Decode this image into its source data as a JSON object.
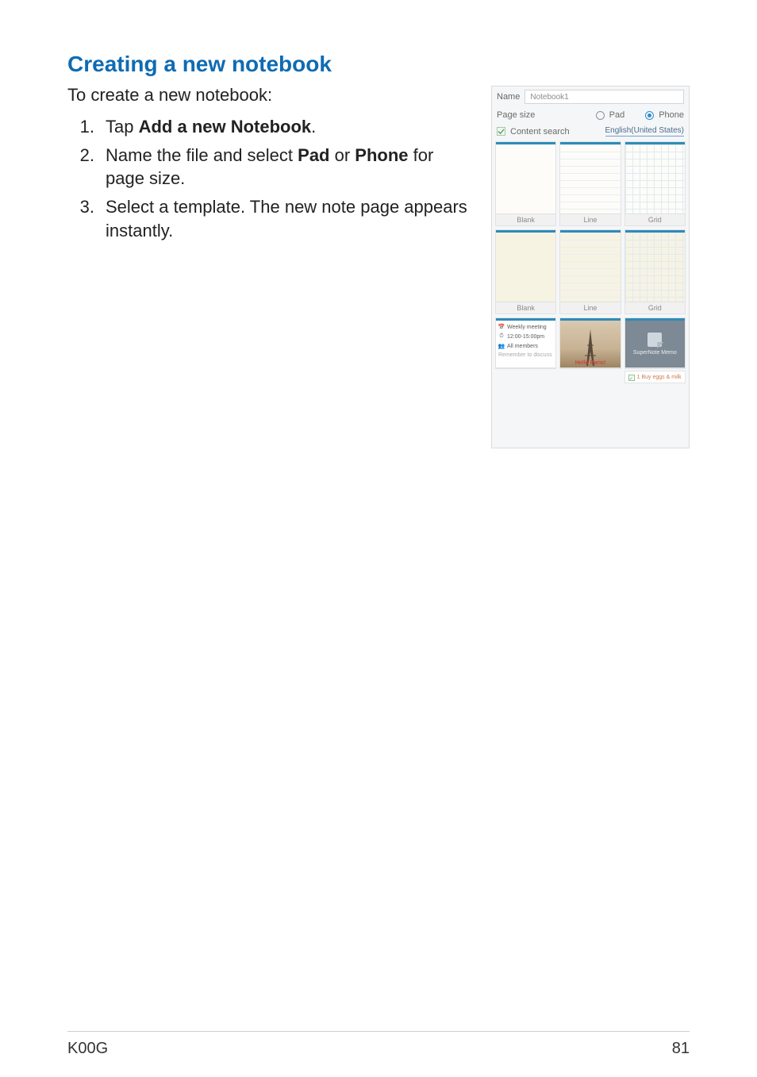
{
  "heading": "Creating a new notebook",
  "intro": "To create a new notebook:",
  "steps": {
    "s1": {
      "num": "1.",
      "pre": "Tap ",
      "bold": "Add a new Notebook",
      "post": "."
    },
    "s2": {
      "num": "2.",
      "pre": "Name the file and select ",
      "bold1": "Pad",
      "mid": " or ",
      "bold2": "Phone",
      "post": " for page size."
    },
    "s3": {
      "num": "3.",
      "text": "Select a template. The new note page appears instantly."
    }
  },
  "shot": {
    "name_label": "Name",
    "name_value": "Notebook1",
    "page_size_label": "Page size",
    "page_size_options": {
      "pad": "Pad",
      "phone": "Phone"
    },
    "content_search_label": "Content search",
    "language": "English(United States)",
    "templates": {
      "row1": {
        "blank": "Blank",
        "line": "Line",
        "grid": "Grid"
      },
      "row2": {
        "blank": "Blank",
        "line": "Line",
        "grid": "Grid"
      },
      "row3": {
        "meeting": {
          "title": "Weekly meeting",
          "time": "12:00-15:00pm",
          "who": "All members",
          "note": "Remember to discuss"
        },
        "paris": "Hello Paris!",
        "memo": "SuperNote Memo",
        "todo": "1 Buy eggs & milk"
      }
    }
  },
  "footer": {
    "left": "K00G",
    "right": "81"
  }
}
